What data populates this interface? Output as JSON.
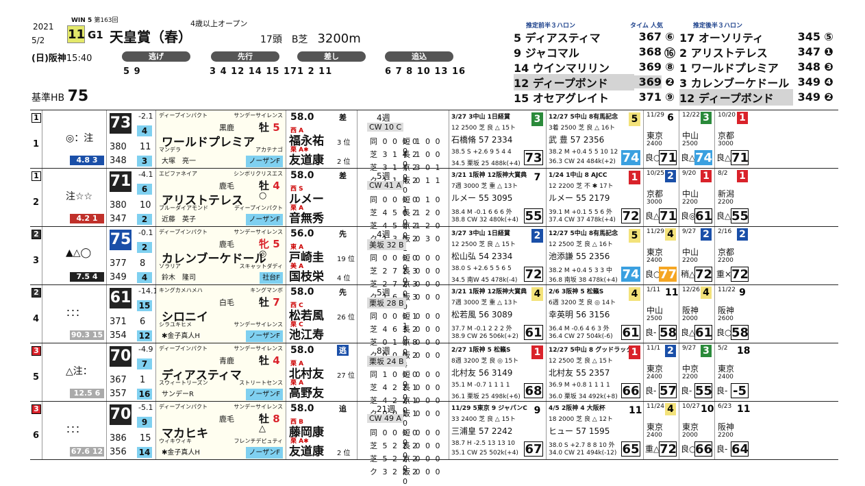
{
  "header": {
    "year": "2021",
    "date": "5/2",
    "day": "(日)",
    "venue": "阪神",
    "time": "15:40",
    "win5": "WIN 5",
    "win5_no": "第163回",
    "race_no": "11",
    "grade": "G1",
    "race_name": "天皇賞（春）",
    "condition": "4歳以上オープン",
    "field": "17頭",
    "course": "B芝",
    "distance": "3200m",
    "styles": [
      {
        "label": "逃げ",
        "horses": "5 9"
      },
      {
        "label": "先行",
        "horses": "3 4 12 14 15 17"
      },
      {
        "label": "差し",
        "horses": "1 2 11"
      },
      {
        "label": "追込",
        "horses": "6 7 8 10 13 16"
      }
    ],
    "base_label": "基準HB",
    "base_value": "75"
  },
  "forecast": {
    "front_title": "推定前半３ハロン",
    "time_label": "タイム 人気",
    "back_title": "推定後半３ハロン",
    "front": [
      {
        "n": "5",
        "name": "ディアスティマ",
        "v": "367",
        "r": "⑥"
      },
      {
        "n": "9",
        "name": "ジャコマル",
        "v": "368",
        "r": "⑯"
      },
      {
        "n": "14",
        "name": "ウインマリリン",
        "v": "369",
        "r": "⑧"
      },
      {
        "n": "12",
        "name": "ディープボンド",
        "v": "369",
        "r": "❷"
      },
      {
        "n": "15",
        "name": "オセアグレイト",
        "v": "371",
        "r": "⑨"
      }
    ],
    "back": [
      {
        "n": "17",
        "name": "オーソリティ",
        "v": "345",
        "r": "⑤"
      },
      {
        "n": "2",
        "name": "アリストテレス",
        "v": "347",
        "r": "❶"
      },
      {
        "n": "1",
        "name": "ワールドプレミア",
        "v": "348",
        "r": "❸"
      },
      {
        "n": "3",
        "name": "カレンブーケドール",
        "v": "349",
        "r": "❹"
      },
      {
        "n": "12",
        "name": "ディープボンド",
        "v": "349",
        "r": "❷"
      }
    ]
  },
  "horses": [
    {
      "gate": "1",
      "num": "1",
      "marks": "◎：注",
      "odds": "4.8",
      "pop": "3",
      "oddsColor": "#1a4fa8",
      "rating": "73",
      "r1": "-2.1",
      "r1b": "4",
      "r2": "380",
      "r2b": "11",
      "r3": "348",
      "r3b": "3",
      "sire": "ディープインパクト",
      "bms": "サンデーサイレンス",
      "coat": "黒鹿",
      "sex": "牡",
      "age": "5",
      "name": "ワールドプレミア",
      "hmark": "",
      "dam": "マンデラ",
      "damsire": "アカテナゴ",
      "trainer": "大塚　亮一",
      "owner": "ノーザンF",
      "wt": "58.0",
      "style": "差",
      "jb": "西 A",
      "jockey": "福永祐",
      "jp1": "3 位",
      "jb2": "栗 A✱",
      "jockey2": "友道康",
      "jp2": "2 位",
      "wk": "4週",
      "wk2": "CW 10 C",
      "recL": [
        "同 0 0 0 0",
        "芝 3 1 4 2",
        "芝 3 1 4 2",
        "ク 1 1 4 2"
      ],
      "recR": [
        "短 1 0 0 0",
        "長 1 0 0 0",
        "京 3 0 1 0",
        "阪 0 1 1 0"
      ],
      "past1": {
        "t": "3/27 3中山 1日経賞",
        "g": "3",
        "gc": "#2a8a3a",
        "l2": "12 2500 芝 良 △ 15ト",
        "l3": "石橋脩 57 2334",
        "l4": "38.5 S +2.6 9 5 4 4",
        "l5": "34.5 栗坂 25 488k(+4)",
        "sc": "73",
        "scb": false
      },
      "past2": {
        "t": "12/27 5中山 8有馬記念",
        "g": "5",
        "gc": "#f3e27a",
        "l2": "3着 2500 芝 良 △ 16ト",
        "l3": "武 豊 57 2356",
        "l4": "38.2 M +0.4 5 5 10 12",
        "l5": "36.3 CW 24 484k(+2)",
        "sc": "74",
        "scb": true
      },
      "m": [
        {
          "d": "11/29",
          "rk": "6",
          "rkc": "#fff",
          "vn": "東京",
          "ds": "2400",
          "cd": "良○",
          "sc": "71",
          "t": ""
        },
        {
          "d": "12/22",
          "rk": "3",
          "rkc": "#2a8a3a",
          "vn": "中山",
          "ds": "2500",
          "cd": "良△",
          "sc": "74",
          "t": "b"
        },
        {
          "d": "10/20",
          "rk": "1",
          "rkc": "#d9222a",
          "vn": "京都",
          "ds": "3000",
          "cd": "良△",
          "sc": "71",
          "t": ""
        }
      ]
    },
    {
      "gate": "1",
      "num": "2",
      "marks": "注☆☆",
      "odds": "4.2",
      "pop": "1",
      "oddsColor": "#c0302a",
      "rating": "71",
      "r1": "-4.1",
      "r1b": "6",
      "r2": "380",
      "r2b": "10",
      "r3": "347",
      "r3b": "2",
      "sire": "エピファネイア",
      "bms": "シンボリクリスエス",
      "coat": "鹿毛",
      "sex": "牡",
      "age": "4",
      "name": "アリストテレス",
      "hmark": "○",
      "dam": "ブルーダイアモンド",
      "damsire": "ディープインパクト",
      "trainer": "近藤　英子",
      "owner": "ノーザンF",
      "wt": "58.0",
      "style": "差",
      "jb": "西 S",
      "jockey": "ルメー",
      "jp1": "",
      "jb2": "栗 A",
      "jockey2": "音無秀",
      "jp2": "",
      "wk": "5週",
      "wk2": "CW 41 A",
      "recL": [
        "同 0 0 0 0",
        "芝 4 5 0 2",
        "芝 4 5 0 2",
        "ク 1 3 0 2"
      ],
      "recR": [
        "短 0 1 0 1",
        "長 1 2 0 0",
        "京 1 2 0 0",
        "阪 0 3 0 1"
      ],
      "past1": {
        "t": "3/21 1阪神 12阪神大賞典",
        "g": "7",
        "gc": "#fff",
        "l2": "7週 3000 芝 重 △ 13ト",
        "l3": "ルメー 55 3095",
        "l4": "38.4 M -0.1 6 6 6 外",
        "l5": "38.8 CW 32 480k(+4)",
        "sc": "55",
        "scb": false
      },
      "past2": {
        "t": "1/24 1中山 8 AJCC",
        "g": "1",
        "gc": "#d9222a",
        "l2": "12 2200 芝 不 ✱ 17ト",
        "l3": "ルメー 55 2179",
        "l4": "39.1 M +0.1 5 5 6 外",
        "l5": "37.4 CW 37 478k(+4)",
        "sc": "72",
        "scb": false
      },
      "m": [
        {
          "d": "10/25",
          "rk": "2",
          "rkc": "#1a4fa8",
          "vn": "京都",
          "ds": "3000",
          "cd": "良△",
          "sc": "71",
          "t": ""
        },
        {
          "d": "9/20",
          "rk": "1",
          "rkc": "#d9222a",
          "vn": "中山",
          "ds": "2200",
          "cd": "良◎",
          "sc": "61",
          "t": ""
        },
        {
          "d": "8/2",
          "rk": "1",
          "rkc": "#d9222a",
          "vn": "新潟",
          "ds": "2200",
          "cd": "良△",
          "sc": "55",
          "t": ""
        }
      ]
    },
    {
      "gate": "2",
      "num": "3",
      "marks": "▲△◯",
      "odds": "7.5",
      "pop": "4",
      "oddsColor": "#222",
      "rating": "75",
      "r1": "-0.1",
      "r1b": "2",
      "r2": "377",
      "r2b": "8",
      "r3": "349",
      "r3b": "4",
      "sire": "ディープインパクト",
      "bms": "サンデーサイレンス",
      "coat": "鹿毛",
      "sex": "牝",
      "age": "5",
      "name": "カレンブーケドール",
      "hmark": "◎",
      "dam": "ソラリア",
      "damsire": "スキャットダディ",
      "trainer": "鈴木　隆司",
      "owner": "社台F",
      "wt": "56.0",
      "style": "先",
      "jb": "東 A",
      "jockey": "戸崎圭",
      "jp1": "19 位",
      "jb2": "美 A",
      "jockey2": "国枝栄",
      "jp2": "4 位",
      "wk": "4週",
      "wk2": "美坂 32 B",
      "recL": [
        "同 0 0 0 0",
        "芝 2 7 2 3",
        "芝 2 7 2 3",
        "ク 1 6 1 3"
      ],
      "recR": [
        "短 0 0 0 0",
        "長 0 0 0 0",
        "京 0 0 0 0",
        "阪 0 0 0 0"
      ],
      "past1": {
        "t": "3/27 3中山 1日経賞",
        "g": "2",
        "gc": "#1a4fa8",
        "l2": "12 2500 芝 良 △ 15ト",
        "l3": "松山弘 54 2334",
        "l4": "38.0 S +2.6 5 5 6 5",
        "l5": "34.5 南W 45 478k(-4)",
        "sc": "72",
        "scb": false
      },
      "past2": {
        "t": "12/27 5中山 8有馬記念",
        "g": "5",
        "gc": "#f3e27a",
        "l2": "12 2500 芝 良 △ 16ト",
        "l3": "池添謙 55 2356",
        "l4": "38.2 M +0.4 5 3 3 中",
        "l5": "36.8 南坂 38 478k(+4)",
        "sc": "74",
        "scb": true
      },
      "m": [
        {
          "d": "11/29",
          "rk": "4",
          "rkc": "#f3e27a",
          "vn": "東京",
          "ds": "2400",
          "cd": "良○",
          "sc": "77",
          "t": "o"
        },
        {
          "d": "9/27",
          "rk": "2",
          "rkc": "#1a4fa8",
          "vn": "中山",
          "ds": "2200",
          "cd": "稍△",
          "sc": "72",
          "t": ""
        },
        {
          "d": "2/16",
          "rk": "2",
          "rkc": "#1a4fa8",
          "vn": "京都",
          "ds": "2200",
          "cd": "重×",
          "sc": "72",
          "t": ""
        }
      ]
    },
    {
      "gate": "2",
      "num": "4",
      "marks": "：：：",
      "odds": "90.3",
      "pop": "15",
      "oddsColor": "#aaa",
      "rating": "61",
      "r1": "-14.1",
      "r1b": "15",
      "r2": "371",
      "r2b": "6",
      "r3": "354",
      "r3b": "12",
      "sire": "キングカメハメハ",
      "bms": "キングマンボ",
      "coat": "白毛",
      "sex": "牡",
      "age": "7",
      "name": "シロニイ",
      "hmark": "",
      "dam": "シラユキヒメ",
      "damsire": "サンデーサイレンス",
      "trainer": "✱金子真人H",
      "owner": "ノーザンF",
      "wt": "58.0",
      "style": "先",
      "jb": "西 C",
      "jockey": "松若風",
      "jp1": "26 位",
      "jb2": "栗 C",
      "jockey2": "池江寿",
      "jp2": "",
      "wk": "5週",
      "wk2": "栗坂 28 B",
      "recL": [
        "同 0 0 0 1",
        "芝 4 6 3 2",
        "芝 0 1 0 8",
        "ク 0 0 0 2"
      ],
      "recR": [
        "短 0 0 0 1",
        "長 0 0 0 0",
        "京 0 0 0 0",
        "阪 0 0 0 4"
      ],
      "past1": {
        "t": "3/21 1阪神 12阪神大賞典",
        "g": "4",
        "gc": "#f3e27a",
        "l2": "7週 3000 芝 重 △ 13ト",
        "l3": "松若風 56 3089",
        "l4": "37.7 M -0.1 2 2 2 外",
        "l5": "38.9 CW 26 506k(+2)",
        "sc": "61",
        "scb": false
      },
      "past2": {
        "t": "2/6 3阪神 5 松籟S",
        "g": "4",
        "gc": "#f3e27a",
        "l2": "6週 3200 芝 良 ◎ 14ト",
        "l3": "幸英明 56 3156",
        "l4": "36.4 M -0.6 4 6 3 外",
        "l5": "36.4 CW 27 504k(-6)",
        "sc": "61",
        "scb": false
      },
      "m": [
        {
          "d": "1/11",
          "rk": "11",
          "rkc": "#fff",
          "vn": "中山",
          "ds": "2500",
          "cd": "良-",
          "sc": "58",
          "t": ""
        },
        {
          "d": "12/26",
          "rk": "4",
          "rkc": "#f3e27a",
          "vn": "阪神",
          "ds": "2000",
          "cd": "良△",
          "sc": "61",
          "t": ""
        },
        {
          "d": "11/22",
          "rk": "9",
          "rkc": "#fff",
          "vn": "阪神",
          "ds": "2600",
          "cd": "良○",
          "sc": "58",
          "t": ""
        }
      ]
    },
    {
      "gate": "3",
      "num": "5",
      "marks": "△注：",
      "odds": "12.5",
      "pop": "6",
      "oddsColor": "#aaa",
      "rating": "70",
      "r1": "-4.9",
      "r1b": "7",
      "r2": "367",
      "r2b": "1",
      "r3": "357",
      "r3b": "16",
      "sire": "ディープインパクト",
      "bms": "サンデーサイレンス",
      "coat": "青鹿",
      "sex": "牡",
      "age": "4",
      "name": "ディアスティマ",
      "hmark": "",
      "dam": "スウィートリーズン",
      "damsire": "ストリートセンス",
      "trainer": "サンデーR",
      "owner": "ノーザンF",
      "wt": "58.0",
      "style": "逃",
      "jb": "栗 A",
      "jockey": "北村友",
      "jp1": "27 位",
      "jb2": "栗 A",
      "jockey2": "高野友",
      "jp2": "",
      "wk": "8週",
      "wk2": "栗坂 24 B",
      "recL": [
        "同 1 0 0 0",
        "芝 4 2 2 1",
        "芝 4 2 2 1",
        "ク 0 0 1 1"
      ],
      "recR": [
        "短 0 0 0 0",
        "長 0 0 0 0",
        "京 0 0 0 0",
        "阪 0 0 0 0"
      ],
      "past1": {
        "t": "2/27 1阪神 5 松籟S",
        "g": "1",
        "gc": "#d9222a",
        "l2": "8週 3200 芝 良 ◎ 15ト",
        "l3": "北村友 56 3149",
        "l4": "35.1 M -0.7 1 1 1 1",
        "l5": "36.1 栗坂 25 498k(+6)",
        "sc": "68",
        "scb": false
      },
      "past2": {
        "t": "12/27 5中山 8 グッドラック",
        "g": "1",
        "gc": "#d9222a",
        "l2": "12 2500 芝 良 △ 15ト",
        "l3": "北村友 55 2357",
        "l4": "36.9 M +0.8 1 1 1 1",
        "l5": "36.0 栗坂 34 492k(+8)",
        "sc": "66",
        "scb": false
      },
      "m": [
        {
          "d": "11/1",
          "rk": "2",
          "rkc": "#1a4fa8",
          "vn": "東京",
          "ds": "2400",
          "cd": "良-",
          "sc": "57",
          "t": ""
        },
        {
          "d": "9/27",
          "rk": "3",
          "rkc": "#2a8a3a",
          "vn": "中京",
          "ds": "2200",
          "cd": "良-",
          "sc": "55",
          "t": ""
        },
        {
          "d": "5/2",
          "rk": "18",
          "rkc": "#fff",
          "vn": "東京",
          "ds": "2400",
          "cd": "良-",
          "sc": "-5",
          "t": ""
        }
      ]
    },
    {
      "gate": "3",
      "num": "6",
      "marks": "：：：",
      "odds": "67.6",
      "pop": "12",
      "oddsColor": "#aaa",
      "rating": "70",
      "r1": "-5.1",
      "r1b": "9",
      "r2": "386",
      "r2b": "15",
      "r3": "356",
      "r3b": "14",
      "sire": "ディープインパクト",
      "bms": "サンデーサイレンス",
      "coat": "鹿毛",
      "sex": "牡",
      "age": "8",
      "name": "マカヒキ",
      "hmark": "△",
      "dam": "ウィキウィキ",
      "damsire": "フレンチデピュティ",
      "trainer": "✱金子真人H",
      "owner": "ノーザンF",
      "wt": "58.0",
      "style": "追",
      "jb": "西 B",
      "jockey": "藤岡康",
      "jp1": "",
      "jb2": "栗 A✱",
      "jockey2": "友道康",
      "jp2": "2 位",
      "wk": "21週",
      "wk2": "CW 49 A",
      "recL": [
        "同 0 0 0 0",
        "芝 5 2 2 2",
        "芝 5 2 2 2",
        "ク 3 2 2 2"
      ],
      "recR": [
        "短 0 0 0 0",
        "長 0 0 0 0",
        "京 0 0 0 0",
        "阪 0 0 0 0"
      ],
      "past1": {
        "t": "11/29 5東京 9 ジャパンC",
        "g": "9",
        "gc": "#fff",
        "l2": "33 2400 芝 良 △ 15ト",
        "l3": "三浦皇 57 2242",
        "l4": "38.7 H -2.5 13 13 10",
        "l5": "35.1 CW 25 502k(+4)",
        "sc": "67",
        "scb": false
      },
      "past2": {
        "t": "4/5 2阪神 4 大阪杯",
        "g": "11",
        "gc": "#fff",
        "l2": "18 2000 芝 良 △ 12ト",
        "l3": "ヒュー 57 1595",
        "l4": "38.0 S +2.7 8 8 10 外",
        "l5": "34.0 CW 21 494k(-12)",
        "sc": "65",
        "scb": false
      },
      "m": [
        {
          "d": "11/24",
          "rk": "4",
          "rkc": "#f3e27a",
          "vn": "東京",
          "ds": "2400",
          "cd": "重△",
          "sc": "72",
          "t": ""
        },
        {
          "d": "10/27",
          "rk": "10",
          "rkc": "#fff",
          "vn": "東京",
          "ds": "2000",
          "cd": "良○",
          "sc": "66",
          "t": ""
        },
        {
          "d": "6/23",
          "rk": "11",
          "rkc": "#fff",
          "vn": "阪神",
          "ds": "2200",
          "cd": "良-",
          "sc": "64",
          "t": ""
        }
      ]
    }
  ]
}
